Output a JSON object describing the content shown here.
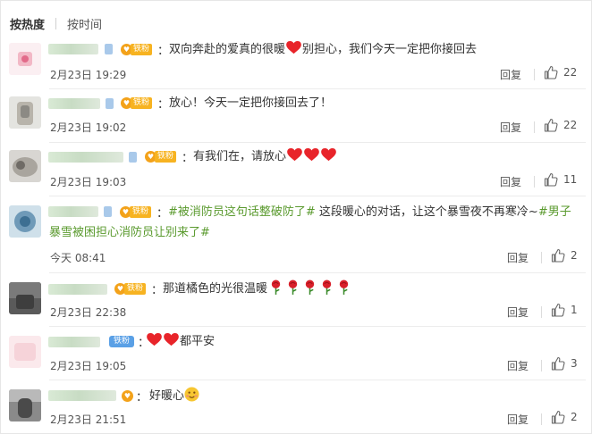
{
  "sort": {
    "hot": "按热度",
    "time": "按时间"
  },
  "reply_label": "回复",
  "comments": [
    {
      "badge": "铁粉",
      "text": "双向奔赴的爱真的很暖",
      "text2": "别担心，我们今天一定把你接回去",
      "date": "2月23日 19:29",
      "likes": "22"
    },
    {
      "badge": "铁粉",
      "text": "放心！今天一定把你接回去了！",
      "date": "2月23日 19:02",
      "likes": "22"
    },
    {
      "badge": "铁粉",
      "text": "有我们在，请放心",
      "date": "2月23日 19:03",
      "likes": "11"
    },
    {
      "badge": "铁粉",
      "topic1": "#被消防员这句话整破防了#",
      "text": " 这段暖心的对话，让这个暴雪夜不再寒冷~",
      "topic2a": "#男子",
      "topic2b": "暴雪被困担心消防员让别来了#",
      "date": "今天 08:41",
      "likes": "2"
    },
    {
      "badge": "铁粉",
      "text": "那道橘色的光很温暖",
      "date": "2月23日 22:38",
      "likes": "1"
    },
    {
      "badge": "铁粉",
      "text": "都平安",
      "date": "2月23日 19:05",
      "likes": "3"
    },
    {
      "badge": "",
      "text": "好暖心",
      "date": "2月23日 21:51",
      "likes": "2"
    }
  ]
}
